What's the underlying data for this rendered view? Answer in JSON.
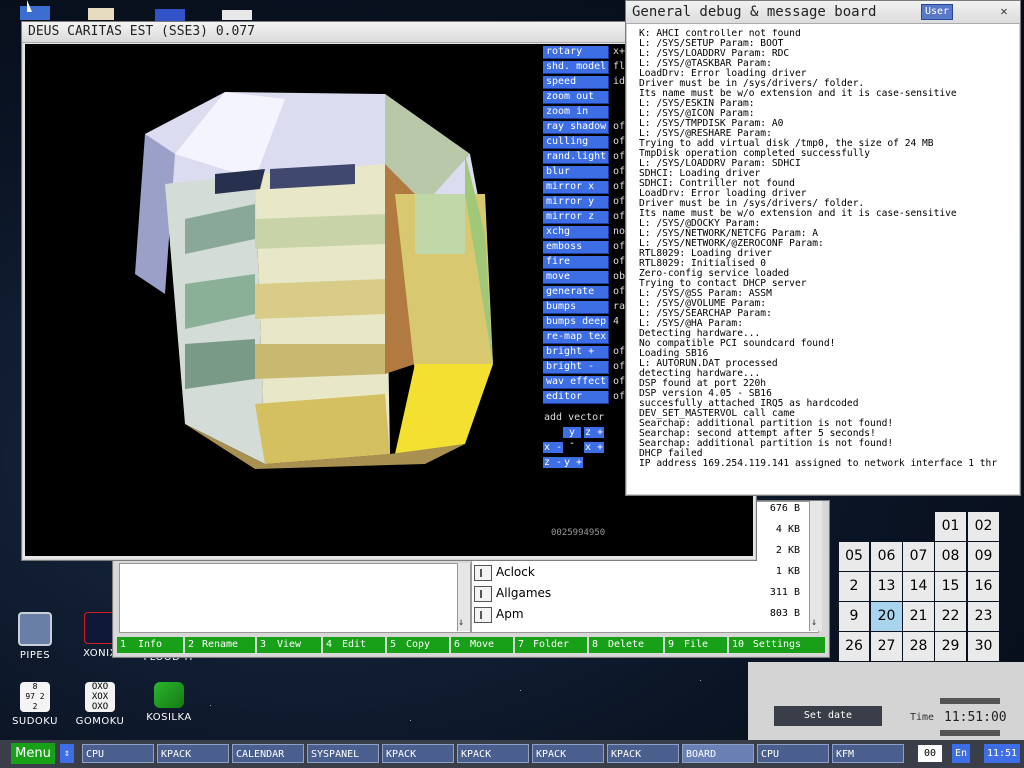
{
  "desktop": {
    "icons": [
      {
        "label": "PIPES"
      },
      {
        "label": "XONIX"
      },
      {
        "label": "FLOOD-IT"
      },
      {
        "label": "SUDOKU"
      },
      {
        "label": "GOMOKU"
      },
      {
        "label": "KOSILKA"
      }
    ]
  },
  "window_3d": {
    "title": "DEUS CARITAS EST (SSE3) 0.077",
    "buttons": [
      {
        "label": "rotary",
        "value": "x+"
      },
      {
        "label": "shd. model",
        "value": "fl"
      },
      {
        "label": "speed",
        "value": "id"
      },
      {
        "label": "zoom out",
        "value": ""
      },
      {
        "label": "zoom in",
        "value": ""
      },
      {
        "label": "ray shadow",
        "value": "of"
      },
      {
        "label": "culling",
        "value": "of"
      },
      {
        "label": "rand.light",
        "value": "of"
      },
      {
        "label": "blur",
        "value": "of"
      },
      {
        "label": "mirror x",
        "value": "of"
      },
      {
        "label": "mirror y",
        "value": "of"
      },
      {
        "label": "mirror z",
        "value": "of"
      },
      {
        "label": "xchg",
        "value": "no"
      },
      {
        "label": "emboss",
        "value": "of"
      },
      {
        "label": "fire",
        "value": "of"
      },
      {
        "label": "move",
        "value": "ob"
      },
      {
        "label": "generate",
        "value": "of"
      },
      {
        "label": "bumps",
        "value": "ra"
      },
      {
        "label": "bumps deep",
        "value": "4"
      },
      {
        "label": "re-map tex",
        "value": ""
      },
      {
        "label": "bright +",
        "value": "of"
      },
      {
        "label": "bright -",
        "value": "of"
      },
      {
        "label": "wav effect",
        "value": "of"
      },
      {
        "label": "editor",
        "value": "of"
      }
    ],
    "add_vector_label": "add vector",
    "vector_buttons": {
      "y_minus": "y -",
      "z_plus": "z +",
      "x_minus": "x -",
      "x_plus": "x +",
      "z_minus": "z -",
      "y_plus": "y +"
    },
    "counter": "0025994950"
  },
  "file_manager": {
    "files": [
      {
        "name": "",
        "size": "676 B"
      },
      {
        "name": "",
        "size": "4 KB"
      },
      {
        "name": "",
        "size": "2 KB"
      },
      {
        "name": "Aclock",
        "size": "1 KB"
      },
      {
        "name": "Allgames",
        "size": "311 B"
      },
      {
        "name": "Apm",
        "size": "803 B"
      }
    ],
    "fkeys": [
      {
        "num": "1",
        "label": "Info"
      },
      {
        "num": "2",
        "label": "Rename"
      },
      {
        "num": "3",
        "label": "View"
      },
      {
        "num": "4",
        "label": "Edit"
      },
      {
        "num": "5",
        "label": "Copy"
      },
      {
        "num": "6",
        "label": "Move"
      },
      {
        "num": "7",
        "label": "Folder"
      },
      {
        "num": "8",
        "label": "Delete"
      },
      {
        "num": "9",
        "label": "File"
      },
      {
        "num": "10",
        "label": "Settings"
      }
    ]
  },
  "debug_board": {
    "title": "General debug & message board",
    "user_button": "User",
    "close_icon_label": "✕",
    "log": [
      "K: AHCI controller not found",
      "L: /SYS/SETUP Param: BOOT",
      "L: /SYS/LOADDRV Param: RDC",
      "L: /SYS/@TASKBAR Param:",
      "LoadDrv: Error loading driver",
      "Driver must be in /sys/drivers/ folder.",
      "Its name must be w/o extension and it is case-sensitive",
      "L: /SYS/ESKIN Param:",
      "L: /SYS/@ICON Param:",
      "L: /SYS/TMPDISK Param: A0",
      "L: /SYS/@RESHARE Param:",
      "Trying to add virtual disk /tmp0, the size of 24 MB",
      "TmpDisk operation completed successfully",
      "L: /SYS/LOADDRV Param: SDHCI",
      "SDHCI: Loading driver",
      "SDHCI: Contriller not found",
      "LoadDrv: Error loading driver",
      "Driver must be in /sys/drivers/ folder.",
      "Its name must be w/o extension and it is case-sensitive",
      "L: /SYS/@DOCKY Param:",
      "L: /SYS/NETWORK/NETCFG Param: A",
      "L: /SYS/NETWORK/@ZEROCONF Param:",
      "RTL8029: Loading driver",
      "RTL8029: Initialised 0",
      "Zero-config service loaded",
      "Trying to contact DHCP server",
      "L: /SYS/@SS Param: ASSM",
      "L: /SYS/@VOLUME Param:",
      "L: /SYS/SEARCHAP Param:",
      "L: /SYS/@HA Param:",
      "Detecting hardware...",
      "No compatible PCI soundcard found!",
      "Loading SB16",
      "L: AUTORUN.DAT processed",
      "detecting hardware...",
      "DSP found at port 220h",
      "DSP version 4.05 - SB16",
      "succesfully attached IRQ5 as hardcoded",
      "DEV_SET_MASTERVOL call came",
      "Searchap: additional partition is not found!",
      "Searchap: second attempt after 5 seconds!",
      "Searchap: additional partition is not found!",
      "DHCP failed",
      "IP address 169.254.119.141 assigned to network interface 1 thr"
    ]
  },
  "calendar": {
    "days": [
      "01",
      "02",
      "05",
      "06",
      "07",
      "08",
      "09",
      "2",
      "13",
      "14",
      "15",
      "16",
      "9",
      "20",
      "21",
      "22",
      "23",
      "26",
      "27",
      "28",
      "29",
      "30"
    ],
    "today": "20"
  },
  "clock_panel": {
    "set_date_label": "Set date",
    "time_label": "Time",
    "time_value": "11:51:00"
  },
  "taskbar": {
    "menu_label": "Menu",
    "tasks": [
      "CPU",
      "KPACK",
      "CALENDAR",
      "SYSPANEL",
      "KPACK",
      "KPACK",
      "KPACK",
      "KPACK",
      "BOARD",
      "CPU",
      "KFM"
    ],
    "page_counter": "00",
    "lang": "En",
    "clock": "11:51"
  },
  "colors": {
    "accent_blue": "#3d6ee6",
    "fkey_green": "#18a018",
    "today_highlight": "#a8d4ee"
  }
}
